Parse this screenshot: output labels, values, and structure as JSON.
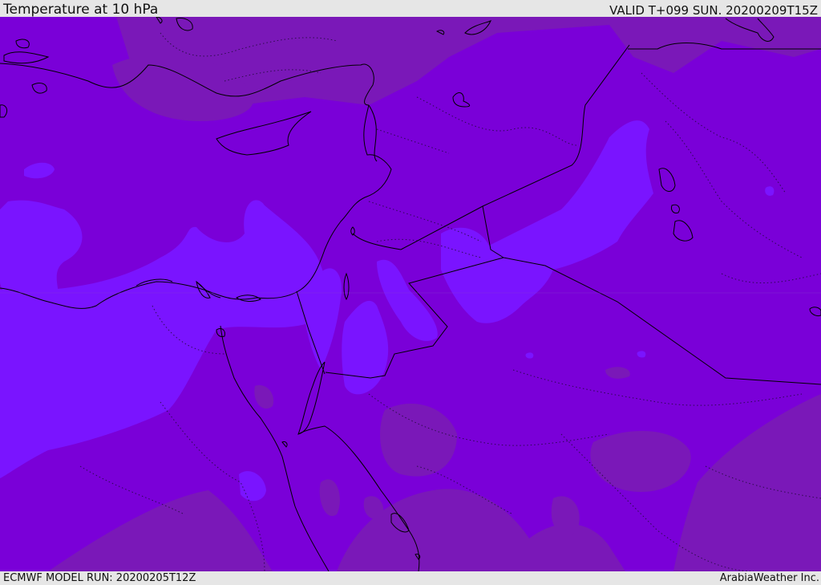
{
  "header": {
    "title": "Temperature at 10 hPa",
    "valid": "VALID T+099 SUN. 20200209T15Z"
  },
  "footer": {
    "model_run": "ECMWF MODEL RUN: 20200205T12Z",
    "credit": "ArabiaWeather Inc."
  },
  "colors": {
    "field_base": "#7a00d8",
    "field_cold": "#7a14ff",
    "field_warm": "#7a18b8",
    "coastline": "#000000",
    "border": "#1a0a30",
    "bar_background": "#e6e6e6"
  }
}
